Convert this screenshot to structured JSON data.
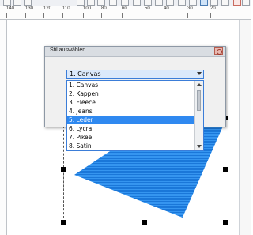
{
  "ruler": {
    "ticks": [
      "140",
      "130",
      "120",
      "110",
      "100",
      "80",
      "60",
      "50",
      "40",
      "30",
      "20"
    ]
  },
  "dialog": {
    "title": "Stil auswählen",
    "combo_value": "1. Canvas",
    "options": [
      "1. Canvas",
      "2. Kappen",
      "3. Fleece",
      "4. Jeans",
      "5. Leder",
      "6. Lycra",
      "7. Pikee",
      "8. Satin"
    ],
    "selected_index": 4
  },
  "colors": {
    "selection": "#2f89f0",
    "hatch": "#1a77d9"
  }
}
